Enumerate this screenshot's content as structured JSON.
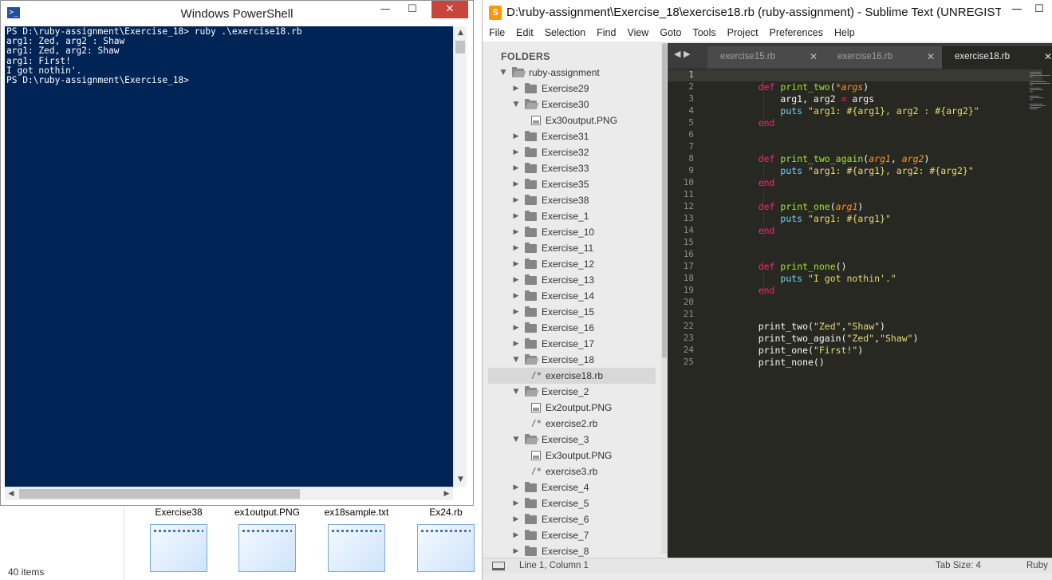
{
  "explorer": {
    "files": [
      {
        "name": "Exercise38"
      },
      {
        "name": "ex1output.PNG"
      },
      {
        "name": "ex18sample.txt"
      },
      {
        "name": "Ex24.rb"
      }
    ],
    "status": "40 items"
  },
  "powershell": {
    "title": "Windows PowerShell",
    "buttons": {
      "minimize": "—",
      "maximize": "☐",
      "close": "✕"
    },
    "console_lines": [
      "PS D:\\ruby-assignment\\Exercise_18> ruby .\\exercise18.rb",
      "arg1: Zed, arg2 : Shaw",
      "arg1: Zed, arg2: Shaw",
      "arg1: First!",
      "I got nothin'.",
      "PS D:\\ruby-assignment\\Exercise_18>"
    ]
  },
  "sublime": {
    "title": "D:\\ruby-assignment\\Exercise_18\\exercise18.rb (ruby-assignment) - Sublime Text (UNREGISTE...",
    "buttons": {
      "minimize": "—",
      "maximize": "☐",
      "close": "✕"
    },
    "menu": [
      "File",
      "Edit",
      "Selection",
      "Find",
      "View",
      "Goto",
      "Tools",
      "Project",
      "Preferences",
      "Help"
    ],
    "sidebar": {
      "heading": "FOLDERS",
      "tree": [
        {
          "label": "ruby-assignment",
          "level": 0,
          "kind": "folder",
          "open": true
        },
        {
          "label": "Exercise29",
          "level": 1,
          "kind": "folder",
          "open": false
        },
        {
          "label": "Exercise30",
          "level": 1,
          "kind": "folder",
          "open": true
        },
        {
          "label": "Ex30output.PNG",
          "level": 2,
          "kind": "image"
        },
        {
          "label": "Exercise31",
          "level": 1,
          "kind": "folder",
          "open": false
        },
        {
          "label": "Exercise32",
          "level": 1,
          "kind": "folder",
          "open": false
        },
        {
          "label": "Exercise33",
          "level": 1,
          "kind": "folder",
          "open": false
        },
        {
          "label": "Exercise35",
          "level": 1,
          "kind": "folder",
          "open": false
        },
        {
          "label": "Exercise38",
          "level": 1,
          "kind": "folder",
          "open": false
        },
        {
          "label": "Exercise_1",
          "level": 1,
          "kind": "folder",
          "open": false
        },
        {
          "label": "Exercise_10",
          "level": 1,
          "kind": "folder",
          "open": false
        },
        {
          "label": "Exercise_11",
          "level": 1,
          "kind": "folder",
          "open": false
        },
        {
          "label": "Exercise_12",
          "level": 1,
          "kind": "folder",
          "open": false
        },
        {
          "label": "Exercise_13",
          "level": 1,
          "kind": "folder",
          "open": false
        },
        {
          "label": "Exercise_14",
          "level": 1,
          "kind": "folder",
          "open": false
        },
        {
          "label": "Exercise_15",
          "level": 1,
          "kind": "folder",
          "open": false
        },
        {
          "label": "Exercise_16",
          "level": 1,
          "kind": "folder",
          "open": false
        },
        {
          "label": "Exercise_17",
          "level": 1,
          "kind": "folder",
          "open": false
        },
        {
          "label": "Exercise_18",
          "level": 1,
          "kind": "folder",
          "open": true
        },
        {
          "label": "exercise18.rb",
          "level": 2,
          "kind": "rb",
          "selected": true
        },
        {
          "label": "Exercise_2",
          "level": 1,
          "kind": "folder",
          "open": true
        },
        {
          "label": "Ex2output.PNG",
          "level": 2,
          "kind": "image"
        },
        {
          "label": "exercise2.rb",
          "level": 2,
          "kind": "rb"
        },
        {
          "label": "Exercise_3",
          "level": 1,
          "kind": "folder",
          "open": true
        },
        {
          "label": "Ex3output.PNG",
          "level": 2,
          "kind": "image"
        },
        {
          "label": "exercise3.rb",
          "level": 2,
          "kind": "rb"
        },
        {
          "label": "Exercise_4",
          "level": 1,
          "kind": "folder",
          "open": false
        },
        {
          "label": "Exercise_5",
          "level": 1,
          "kind": "folder",
          "open": false
        },
        {
          "label": "Exercise_6",
          "level": 1,
          "kind": "folder",
          "open": false
        },
        {
          "label": "Exercise_7",
          "level": 1,
          "kind": "folder",
          "open": false
        },
        {
          "label": "Exercise_8",
          "level": 1,
          "kind": "folder",
          "open": false
        }
      ]
    },
    "tabs": [
      {
        "label": "exercise15.rb",
        "active": false
      },
      {
        "label": "exercise16.rb",
        "active": false
      },
      {
        "label": "exercise18.rb",
        "active": true
      }
    ],
    "code_lines": [
      [],
      [
        [
          "    ",
          ""
        ],
        [
          "def",
          "k"
        ],
        [
          " ",
          ""
        ],
        [
          "print_two",
          "f"
        ],
        [
          "(",
          ""
        ],
        [
          "*args",
          "p"
        ],
        [
          ")",
          ""
        ]
      ],
      [
        [
          "        arg1, arg2 ",
          ""
        ],
        [
          "=",
          "o"
        ],
        [
          " args",
          ""
        ]
      ],
      [
        [
          "        ",
          ""
        ],
        [
          "puts",
          "b"
        ],
        [
          " ",
          ""
        ],
        [
          "\"arg1: #{arg1}, arg2 : #{arg2}\"",
          "s"
        ]
      ],
      [
        [
          "    ",
          ""
        ],
        [
          "end",
          "k"
        ]
      ],
      [],
      [],
      [
        [
          "    ",
          ""
        ],
        [
          "def",
          "k"
        ],
        [
          " ",
          ""
        ],
        [
          "print_two_again",
          "f"
        ],
        [
          "(",
          ""
        ],
        [
          "arg1",
          "p"
        ],
        [
          ", ",
          ""
        ],
        [
          "arg2",
          "p"
        ],
        [
          ")",
          ""
        ]
      ],
      [
        [
          "        ",
          ""
        ],
        [
          "puts",
          "b"
        ],
        [
          " ",
          ""
        ],
        [
          "\"arg1: #{arg1}, arg2: #{arg2}\"",
          "s"
        ]
      ],
      [
        [
          "    ",
          ""
        ],
        [
          "end",
          "k"
        ]
      ],
      [],
      [
        [
          "    ",
          ""
        ],
        [
          "def",
          "k"
        ],
        [
          " ",
          ""
        ],
        [
          "print_one",
          "f"
        ],
        [
          "(",
          ""
        ],
        [
          "arg1",
          "p"
        ],
        [
          ")",
          ""
        ]
      ],
      [
        [
          "        ",
          ""
        ],
        [
          "puts",
          "b"
        ],
        [
          " ",
          ""
        ],
        [
          "\"arg1: #{arg1}\"",
          "s"
        ]
      ],
      [
        [
          "    ",
          ""
        ],
        [
          "end",
          "k"
        ]
      ],
      [],
      [],
      [
        [
          "    ",
          ""
        ],
        [
          "def",
          "k"
        ],
        [
          " ",
          ""
        ],
        [
          "print_none",
          "f"
        ],
        [
          "()",
          ""
        ]
      ],
      [
        [
          "        ",
          ""
        ],
        [
          "puts",
          "b"
        ],
        [
          " ",
          ""
        ],
        [
          "\"I got nothin'.\"",
          "s"
        ]
      ],
      [
        [
          "    ",
          ""
        ],
        [
          "end",
          "k"
        ]
      ],
      [],
      [],
      [
        [
          "    print_two(",
          ""
        ],
        [
          "\"Zed\"",
          "s"
        ],
        [
          ",",
          ""
        ],
        [
          "\"Shaw\"",
          "s"
        ],
        [
          ")",
          ""
        ]
      ],
      [
        [
          "    print_two_again(",
          ""
        ],
        [
          "\"Zed\"",
          "s"
        ],
        [
          ",",
          ""
        ],
        [
          "\"Shaw\"",
          "s"
        ],
        [
          ")",
          ""
        ]
      ],
      [
        [
          "    print_one(",
          ""
        ],
        [
          "\"First!\"",
          "s"
        ],
        [
          ")",
          ""
        ]
      ],
      [
        [
          "    print_none()",
          ""
        ]
      ]
    ],
    "status": {
      "position": "Line 1, Column 1",
      "tab_size": "Tab Size: 4",
      "syntax": "Ruby"
    },
    "colors": {
      "editor_bg": "#272822",
      "keyword": "#f92672",
      "function": "#a6e22e",
      "param": "#fd971f",
      "string": "#e6db74",
      "builtin": "#66d9ef",
      "console_bg": "#012456"
    }
  }
}
